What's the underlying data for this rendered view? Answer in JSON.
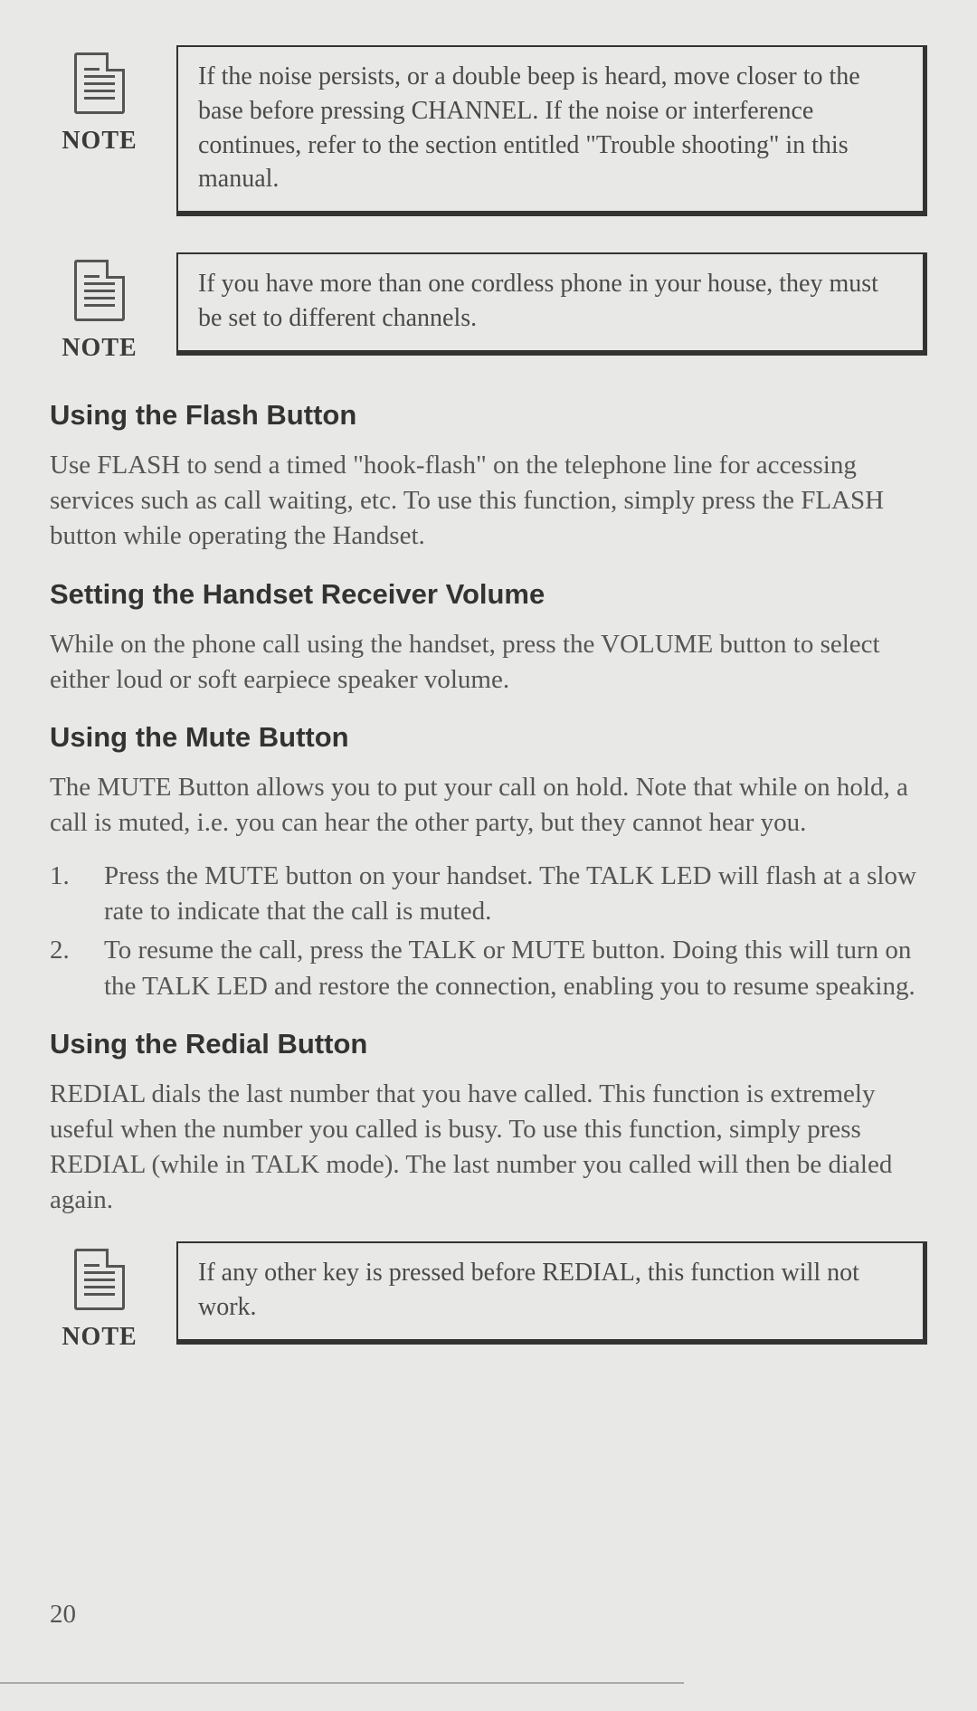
{
  "notes": {
    "label": "NOTE",
    "note1": "If the noise persists, or a double beep is heard, move closer to the base before pressing CHANNEL. If the noise or interference continues, refer to the section entitled \"Trouble shooting\" in this manual.",
    "note2": "If you have more than one cordless phone in your house, they must be set to different channels.",
    "note3": "If any other key is pressed before REDIAL, this function will not work."
  },
  "sections": {
    "flash": {
      "title": "Using the Flash Button",
      "body": "Use FLASH to send a timed \"hook-flash\" on the telephone line for accessing services such as call waiting, etc. To use this function, simply press the FLASH button while operating the Handset."
    },
    "volume": {
      "title": "Setting the Handset Receiver Volume",
      "body": "While on the phone call using the handset, press the VOLUME button to select either loud or soft earpiece speaker volume."
    },
    "mute": {
      "title": "Using the Mute Button",
      "body": "The MUTE Button allows you to put your call on hold. Note that while on hold, a call is muted, i.e. you can hear the other party, but they cannot hear you.",
      "steps": [
        "Press the MUTE button on your handset. The TALK LED will flash at a slow rate to indicate that the call is muted.",
        "To resume the call, press the TALK or MUTE button. Doing this will turn on the TALK LED and restore the connection, enabling you to resume speaking."
      ]
    },
    "redial": {
      "title": "Using the Redial Button",
      "body": "REDIAL dials the last number that you have called. This function is extremely useful when the number you called is busy. To use this function, simply press REDIAL (while in TALK mode). The last number you called will then be dialed again."
    }
  },
  "pageNumber": "20"
}
